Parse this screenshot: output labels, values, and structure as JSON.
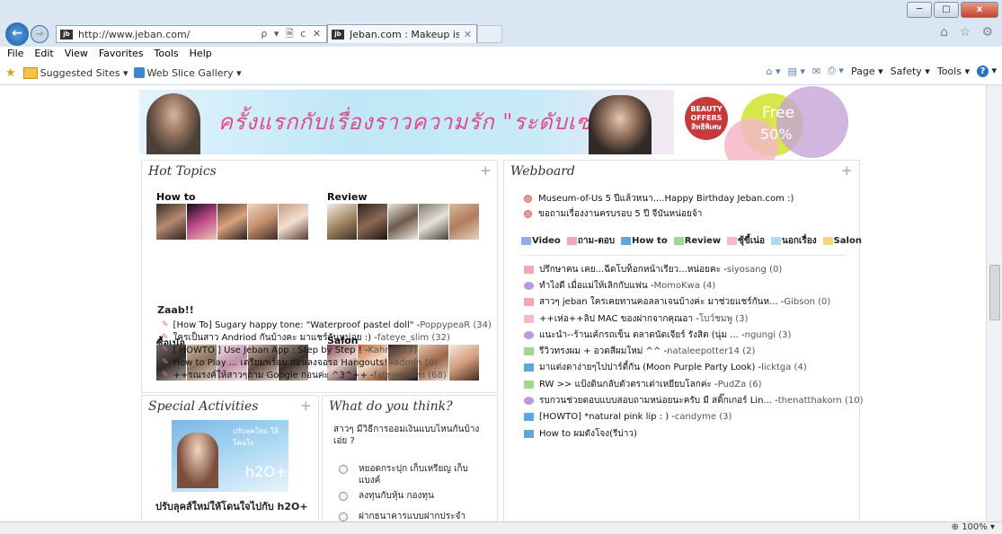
{
  "browser": {
    "url": "http://www.jeban.com/",
    "site_icon": "site-favicon",
    "address_tools": "ρ ▾ 🗎 c ✕",
    "tab_label": "Jeban.com : Makeup is Ma...",
    "tab_close": "✕",
    "nav_icons": "⌂ ☆ ⚙",
    "back_icon": "arrow-left-icon",
    "back_glyph": "←",
    "forward_glyph": "→",
    "window_buttons": {
      "minimize": "─",
      "maximize": "□",
      "close": "x"
    },
    "menu": [
      "File",
      "Edit",
      "View",
      "Favorites",
      "Tools",
      "Help"
    ],
    "favorites": [
      "Suggested Sites ▾",
      "Web Slice Gallery ▾"
    ],
    "commands": [
      "Page ▾",
      "Safety ▾",
      "Tools ▾"
    ],
    "command_icons": [
      "home-icon",
      "feeds-icon",
      "mail-icon",
      "print-icon"
    ],
    "command_glyphs": [
      "⌂ ▾",
      "▤ ▾",
      "✉",
      "⎙ ▾"
    ],
    "help_glyph": "?",
    "help_suffix": "▾",
    "zoom": "⊕ 100%  ▾"
  },
  "banner": {
    "text": "ครั้งแรกกับเรื่องราวความรัก \"ระดับเซลล์\"",
    "offers_badge": "BEAUTY OFFERS สิทธิพิเศษ",
    "offers_free": "Free",
    "offers_pct": "50%"
  },
  "hot_topics": {
    "title": "Hot Topics",
    "plus": "+",
    "sections": [
      "How to",
      "Review",
      "ซื้อเน่อ",
      "Salon"
    ],
    "zaab_title": "Zaab!!",
    "zaab": [
      {
        "text": "[How To] Sugary happy tone: \"Waterproof pastel doll\" - ",
        "author": "PoppypeaR (34)"
      },
      {
        "text": "ใครเป็นสาว Andriod กันบ้างคะ มาแชร์กันหน่อย :) - ",
        "author": "fateye_slim (32)"
      },
      {
        "text": "[ HOWTO ] Use Jeban App : Step by Step ! - ",
        "author": "KahnJi (17)"
      },
      {
        "text": "How to Play ... เตรียมพร้อม ก่อนลงจอรอ Hangouts! - ",
        "author": "admin (0)"
      },
      {
        "text": "++รณรงค์ให้สาวๆถาม Google ก่อนค่ะ ^3^++ - ",
        "author": "fateye_slim (68)"
      }
    ]
  },
  "webboard": {
    "title": "Webboard",
    "plus": "+",
    "top": [
      "Museum-of-Us 5 ปีแล้วหนา....Happy Birthday Jeban.com :)",
      "ขอถามเรื่องงานครบรอบ 5 ปี จีบันหน่อยจ้า"
    ],
    "categories": [
      {
        "label": "Video",
        "color": "#8ab0e6"
      },
      {
        "label": "ถาม-ตอบ",
        "color": "#f0a8b8"
      },
      {
        "label": "How to",
        "color": "#5fa6e0"
      },
      {
        "label": "Review",
        "color": "#9fd88f"
      },
      {
        "label": "ซุ้ขี้เน่อ",
        "color": "#f7b8c8"
      },
      {
        "label": "นอกเรื่อง",
        "color": "#b3d7f0"
      },
      {
        "label": "Salon",
        "color": "#f6d67a"
      }
    ],
    "items": [
      {
        "text": "ปรึกษาคน เคย...ฉีดโบท็อกหน้าเรียว...หน่อยคะ - ",
        "author": "siyosang (0)",
        "icon": "#f0a8b8"
      },
      {
        "text": "ทำไงดี เมื่อแม่ให้เลิกกับแฟน - ",
        "author": "MomoKwa (4)",
        "icon": "#b89ae0"
      },
      {
        "text": "สาวๆ jeban ใครเคยทานคอลลาเจนบ้างค่ะ มาช่วยแชร์กันห... - ",
        "author": "Gibson (0)",
        "icon": "#f0a8b8"
      },
      {
        "text": "++เห่อ++ลิป MAC ของฝากจากคุณอา - ",
        "author": "โบว์ชมพู (3)",
        "icon": "#f7b8c8"
      },
      {
        "text": "แนะนำ--ร้านเค้กรถเข็น ตลาดนัดเจียร์ รังสิต (นุ่ม ...  - ",
        "author": "ngungi (3)",
        "icon": "#b89ae0"
      },
      {
        "text": "รีวิวทรงผม + อวดสีผมใหม่ ^^ - ",
        "author": "nataleepotter14 (2)",
        "icon": "#9fd88f"
      },
      {
        "text": "มาแต่งตาง่ายๆไปปาร์ตี้กัน (Moon Purple Party Look) - ",
        "author": "licktga (4)",
        "icon": "#5fa6e0"
      },
      {
        "text": "RW >> แป้งดินกลับตัวตราเต่าเหยียบโลกค่ะ - ",
        "author": "PudZa (6)",
        "icon": "#9fd88f"
      },
      {
        "text": "รบกวนช่วยตอบแบบสอบถามหน่อยนะครับ มี สติ๊กเกอร์ Lin... - ",
        "author": "thenatthakorn (10)",
        "icon": "#b89ae0"
      },
      {
        "text": "[HOWTO] *natural pink lip : ) - ",
        "author": "candyme (3)",
        "icon": "#5fa6e0"
      },
      {
        "text": "How to ผมตังโจง(รีบ่าว)",
        "author": "",
        "icon": "#5fa6e0"
      }
    ]
  },
  "special": {
    "title": "Special Activities",
    "plus": "+",
    "img_text1": "ปรับลุคใหม่ ให้โดนใจ",
    "img_text2": "h2O+",
    "caption": "ปรับลุคส์ใหม่ให้โดนใจไปกับ h2O+"
  },
  "poll": {
    "title": "What do you think?",
    "question": "สาวๆ มีวิธีการออมเงินแบบไหนกันบ้างเอ่ย ?",
    "options": [
      "หยอดกระปุก เก็บเหรียญ เก็บแบงค์",
      "ลงทุนกับหุ้น กองทุน",
      "ฝากธนาคารแบบฝากประจำ"
    ]
  }
}
